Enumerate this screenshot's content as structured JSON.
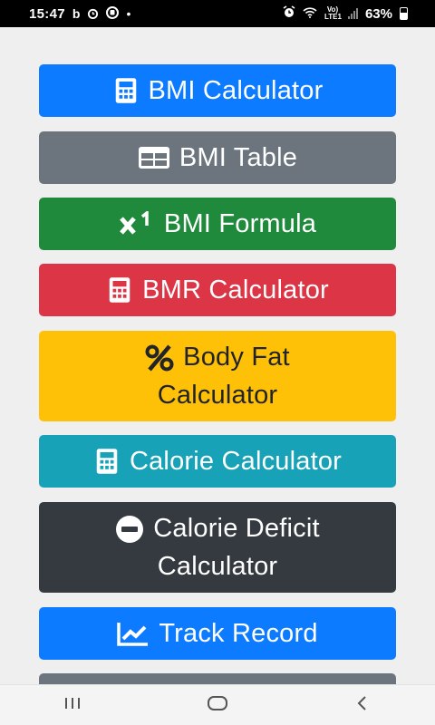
{
  "status_bar": {
    "time": "15:47",
    "notif_icons": [
      "b",
      "⏰",
      "🎯",
      "•"
    ],
    "net_label": "Vo) LTE1",
    "battery": "63%"
  },
  "buttons": [
    {
      "label": "BMI Calculator",
      "icon": "calculator-icon",
      "color": "#0d7bff"
    },
    {
      "label": "BMI Table",
      "icon": "table-icon",
      "color": "#6c757d"
    },
    {
      "label": "BMI Formula",
      "icon": "superscript-icon",
      "color": "#1f8a3b"
    },
    {
      "label": "BMR Calculator",
      "icon": "calculator-icon",
      "color": "#dc3545"
    },
    {
      "label": "Body Fat Calculator",
      "icon": "percent-icon",
      "color": "#ffc107"
    },
    {
      "label": "Calorie Calculator",
      "icon": "calculator-icon",
      "color": "#17a2b8"
    },
    {
      "label": "Calorie Deficit Calculator",
      "icon": "minus-circle-icon",
      "color": "#343a40"
    },
    {
      "label": "Track Record",
      "icon": "chart-line-icon",
      "color": "#0d7bff"
    }
  ],
  "nav": {
    "recents": "recents-icon",
    "home": "home-icon",
    "back": "back-icon"
  }
}
